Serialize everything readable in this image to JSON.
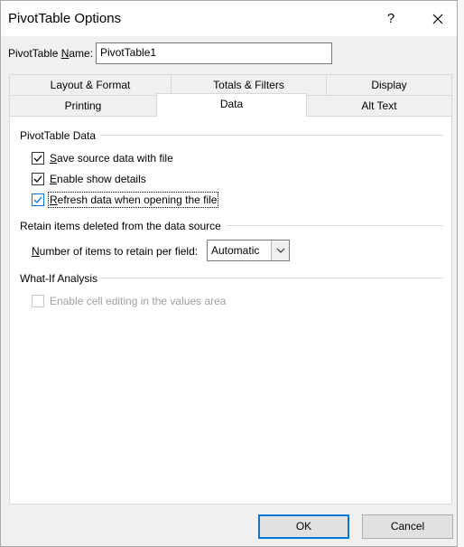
{
  "window": {
    "title": "PivotTable Options",
    "help_label": "?",
    "close_icon": "close-icon"
  },
  "name_field": {
    "label_prefix": "PivotTable ",
    "label_accel": "N",
    "label_suffix": "ame:",
    "value": "PivotTable1"
  },
  "tabs_row1": [
    {
      "label": "Layout & Format"
    },
    {
      "label": "Totals & Filters"
    },
    {
      "label": "Display"
    }
  ],
  "tabs_row2": [
    {
      "label": "Printing"
    },
    {
      "label": "Data",
      "selected": true
    },
    {
      "label": "Alt Text"
    }
  ],
  "pivot_data_group": {
    "title": "PivotTable Data",
    "options": [
      {
        "accel": "S",
        "rest": "ave source data with file",
        "checked": true
      },
      {
        "accel": "E",
        "rest": "nable show details",
        "checked": true
      },
      {
        "accel": "R",
        "rest": "efresh data when opening the file",
        "checked": true,
        "focused": true
      }
    ]
  },
  "retain_group": {
    "title": "Retain items deleted from the data source",
    "label_accel": "N",
    "label_rest": "umber of items to retain per field:",
    "select_value": "Automatic"
  },
  "whatif_group": {
    "title": "What-If Analysis",
    "option_label": "Enable cell editing in the values area",
    "option_checked": false,
    "option_enabled": false
  },
  "buttons": {
    "ok": "OK",
    "cancel": "Cancel"
  },
  "colors": {
    "accent": "#0078d7",
    "dialog_bg": "#f0f0f0",
    "panel_bg": "#ffffff"
  }
}
